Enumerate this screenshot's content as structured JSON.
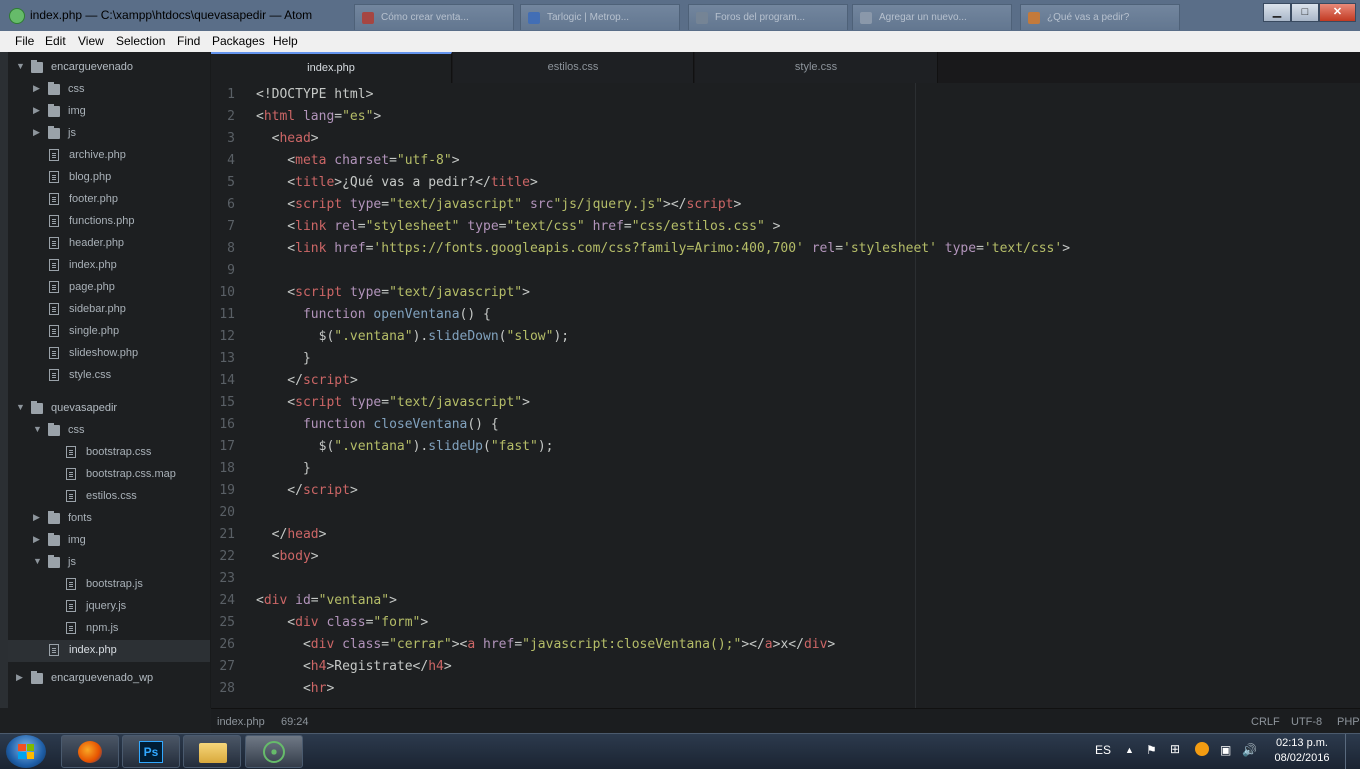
{
  "window": {
    "title": "index.php — C:\\xampp\\htdocs\\quevasapedir — Atom"
  },
  "browser_tabs": [
    {
      "label": "Cómo crear venta...",
      "color": "#c0392b"
    },
    {
      "label": "Tarlogic | Metrop...",
      "color": "#3a6fc4"
    },
    {
      "label": "Foros del program...",
      "color": "#7f8c9a"
    },
    {
      "label": "Agregar un nuevo...",
      "color": "#9aa7b6"
    },
    {
      "label": "¿Qué vas a pedir?",
      "color": "#e67e22"
    }
  ],
  "window_controls": {
    "minimize": "▁",
    "maximize": "□",
    "close": "✕"
  },
  "menu": [
    "File",
    "Edit",
    "View",
    "Selection",
    "Find",
    "Packages",
    "Help"
  ],
  "tree": [
    {
      "type": "folder",
      "label": "encarguevenado",
      "depth": 0,
      "open": true
    },
    {
      "type": "folder",
      "label": "css",
      "depth": 1,
      "open": false
    },
    {
      "type": "folder",
      "label": "img",
      "depth": 1,
      "open": false
    },
    {
      "type": "folder",
      "label": "js",
      "depth": 1,
      "open": false
    },
    {
      "type": "file",
      "label": "archive.php",
      "depth": 1
    },
    {
      "type": "file",
      "label": "blog.php",
      "depth": 1
    },
    {
      "type": "file",
      "label": "footer.php",
      "depth": 1
    },
    {
      "type": "file",
      "label": "functions.php",
      "depth": 1
    },
    {
      "type": "file",
      "label": "header.php",
      "depth": 1
    },
    {
      "type": "file",
      "label": "index.php",
      "depth": 1
    },
    {
      "type": "file",
      "label": "page.php",
      "depth": 1
    },
    {
      "type": "file",
      "label": "sidebar.php",
      "depth": 1
    },
    {
      "type": "file",
      "label": "single.php",
      "depth": 1
    },
    {
      "type": "file",
      "label": "slideshow.php",
      "depth": 1
    },
    {
      "type": "file",
      "label": "style.css",
      "depth": 1
    },
    {
      "type": "folder",
      "label": "quevasapedir",
      "depth": 0,
      "open": true
    },
    {
      "type": "folder",
      "label": "css",
      "depth": 1,
      "open": true
    },
    {
      "type": "file",
      "label": "bootstrap.css",
      "depth": 2
    },
    {
      "type": "file",
      "label": "bootstrap.css.map",
      "depth": 2
    },
    {
      "type": "file",
      "label": "estilos.css",
      "depth": 2
    },
    {
      "type": "folder",
      "label": "fonts",
      "depth": 1,
      "open": false
    },
    {
      "type": "folder",
      "label": "img",
      "depth": 1,
      "open": false
    },
    {
      "type": "folder",
      "label": "js",
      "depth": 1,
      "open": true
    },
    {
      "type": "file",
      "label": "bootstrap.js",
      "depth": 2
    },
    {
      "type": "file",
      "label": "jquery.js",
      "depth": 2
    },
    {
      "type": "file",
      "label": "npm.js",
      "depth": 2
    },
    {
      "type": "file",
      "label": "index.php",
      "depth": 1,
      "selected": true
    },
    {
      "type": "folder",
      "label": "encarguevenado_wp",
      "depth": 0,
      "open": false
    }
  ],
  "tabs": [
    {
      "label": "index.php",
      "active": true
    },
    {
      "label": "estilos.css",
      "active": false
    },
    {
      "label": "style.css",
      "active": false
    }
  ],
  "colors": {
    "tag": "#cc6666",
    "attr": "#b294bb",
    "string": "#b5bd68",
    "keyword": "#b294bb",
    "func": "#81a2be",
    "text": "#c5c8c6",
    "accent": "#6494ed"
  },
  "code": [
    [
      [
        "t",
        "<!DOCTYPE html>"
      ]
    ],
    [
      [
        "t",
        "<"
      ],
      [
        "g",
        "html"
      ],
      [
        "t",
        " "
      ],
      [
        "a",
        "lang"
      ],
      [
        "t",
        "="
      ],
      [
        "s",
        "\"es\""
      ],
      [
        "t",
        ">"
      ]
    ],
    [
      [
        "t",
        "  <"
      ],
      [
        "g",
        "head"
      ],
      [
        "t",
        ">"
      ]
    ],
    [
      [
        "t",
        "    <"
      ],
      [
        "g",
        "meta"
      ],
      [
        "t",
        " "
      ],
      [
        "a",
        "charset"
      ],
      [
        "t",
        "="
      ],
      [
        "s",
        "\"utf-8\""
      ],
      [
        "t",
        ">"
      ]
    ],
    [
      [
        "t",
        "    <"
      ],
      [
        "g",
        "title"
      ],
      [
        "t",
        ">¿Qué vas a pedir?</"
      ],
      [
        "g",
        "title"
      ],
      [
        "t",
        ">"
      ]
    ],
    [
      [
        "t",
        "    <"
      ],
      [
        "g",
        "script"
      ],
      [
        "t",
        " "
      ],
      [
        "a",
        "type"
      ],
      [
        "t",
        "="
      ],
      [
        "s",
        "\"text/javascript\""
      ],
      [
        "t",
        " "
      ],
      [
        "a",
        "src"
      ],
      [
        "s",
        "\"js/jquery.js\""
      ],
      [
        "t",
        "></"
      ],
      [
        "g",
        "script"
      ],
      [
        "t",
        ">"
      ]
    ],
    [
      [
        "t",
        "    <"
      ],
      [
        "g",
        "link"
      ],
      [
        "t",
        " "
      ],
      [
        "a",
        "rel"
      ],
      [
        "t",
        "="
      ],
      [
        "s",
        "\"stylesheet\""
      ],
      [
        "t",
        " "
      ],
      [
        "a",
        "type"
      ],
      [
        "t",
        "="
      ],
      [
        "s",
        "\"text/css\""
      ],
      [
        "t",
        " "
      ],
      [
        "a",
        "href"
      ],
      [
        "t",
        "="
      ],
      [
        "s",
        "\"css/estilos.css\""
      ],
      [
        "t",
        " >"
      ]
    ],
    [
      [
        "t",
        "    <"
      ],
      [
        "g",
        "link"
      ],
      [
        "t",
        " "
      ],
      [
        "a",
        "href"
      ],
      [
        "t",
        "="
      ],
      [
        "s",
        "'https://fonts.googleapis.com/css?family=Arimo:400,700'"
      ],
      [
        "t",
        " "
      ],
      [
        "a",
        "rel"
      ],
      [
        "t",
        "="
      ],
      [
        "s",
        "'stylesheet'"
      ],
      [
        "t",
        " "
      ],
      [
        "a",
        "type"
      ],
      [
        "t",
        "="
      ],
      [
        "s",
        "'text/css'"
      ],
      [
        "t",
        ">"
      ]
    ],
    [
      [
        "t",
        ""
      ]
    ],
    [
      [
        "t",
        "    <"
      ],
      [
        "g",
        "script"
      ],
      [
        "t",
        " "
      ],
      [
        "a",
        "type"
      ],
      [
        "t",
        "="
      ],
      [
        "s",
        "\"text/javascript\""
      ],
      [
        "t",
        ">"
      ]
    ],
    [
      [
        "t",
        "      "
      ],
      [
        "k",
        "function"
      ],
      [
        "t",
        " "
      ],
      [
        "f",
        "openVentana"
      ],
      [
        "t",
        "() {"
      ]
    ],
    [
      [
        "t",
        "        $("
      ],
      [
        "s",
        "\".ventana\""
      ],
      [
        "t",
        ")."
      ],
      [
        "f",
        "slideDown"
      ],
      [
        "t",
        "("
      ],
      [
        "s",
        "\"slow\""
      ],
      [
        "t",
        ");"
      ]
    ],
    [
      [
        "t",
        "      }"
      ]
    ],
    [
      [
        "t",
        "    </"
      ],
      [
        "g",
        "script"
      ],
      [
        "t",
        ">"
      ]
    ],
    [
      [
        "t",
        "    <"
      ],
      [
        "g",
        "script"
      ],
      [
        "t",
        " "
      ],
      [
        "a",
        "type"
      ],
      [
        "t",
        "="
      ],
      [
        "s",
        "\"text/javascript\""
      ],
      [
        "t",
        ">"
      ]
    ],
    [
      [
        "t",
        "      "
      ],
      [
        "k",
        "function"
      ],
      [
        "t",
        " "
      ],
      [
        "f",
        "closeVentana"
      ],
      [
        "t",
        "() {"
      ]
    ],
    [
      [
        "t",
        "        $("
      ],
      [
        "s",
        "\".ventana\""
      ],
      [
        "t",
        ")."
      ],
      [
        "f",
        "slideUp"
      ],
      [
        "t",
        "("
      ],
      [
        "s",
        "\"fast\""
      ],
      [
        "t",
        ");"
      ]
    ],
    [
      [
        "t",
        "      }"
      ]
    ],
    [
      [
        "t",
        "    </"
      ],
      [
        "g",
        "script"
      ],
      [
        "t",
        ">"
      ]
    ],
    [
      [
        "t",
        ""
      ]
    ],
    [
      [
        "t",
        "  </"
      ],
      [
        "g",
        "head"
      ],
      [
        "t",
        ">"
      ]
    ],
    [
      [
        "t",
        "  <"
      ],
      [
        "g",
        "body"
      ],
      [
        "t",
        ">"
      ]
    ],
    [
      [
        "t",
        ""
      ]
    ],
    [
      [
        "t",
        "<"
      ],
      [
        "g",
        "div"
      ],
      [
        "t",
        " "
      ],
      [
        "a",
        "id"
      ],
      [
        "t",
        "="
      ],
      [
        "s",
        "\"ventana\""
      ],
      [
        "t",
        ">"
      ]
    ],
    [
      [
        "t",
        "    <"
      ],
      [
        "g",
        "div"
      ],
      [
        "t",
        " "
      ],
      [
        "a",
        "class"
      ],
      [
        "t",
        "="
      ],
      [
        "s",
        "\"form\""
      ],
      [
        "t",
        ">"
      ]
    ],
    [
      [
        "t",
        "      <"
      ],
      [
        "g",
        "div"
      ],
      [
        "t",
        " "
      ],
      [
        "a",
        "class"
      ],
      [
        "t",
        "="
      ],
      [
        "s",
        "\"cerrar\""
      ],
      [
        "t",
        "><"
      ],
      [
        "g",
        "a"
      ],
      [
        "t",
        " "
      ],
      [
        "a",
        "href"
      ],
      [
        "t",
        "="
      ],
      [
        "s",
        "\"javascript:closeVentana();\""
      ],
      [
        "t",
        "></"
      ],
      [
        "g",
        "a"
      ],
      [
        "t",
        ">x</"
      ],
      [
        "g",
        "div"
      ],
      [
        "t",
        ">"
      ]
    ],
    [
      [
        "t",
        "      <"
      ],
      [
        "g",
        "h4"
      ],
      [
        "t",
        ">Registrate</"
      ],
      [
        "g",
        "h4"
      ],
      [
        "t",
        ">"
      ]
    ],
    [
      [
        "t",
        "      <"
      ],
      [
        "g",
        "hr"
      ],
      [
        "t",
        ">"
      ]
    ]
  ],
  "status": {
    "file": "index.php",
    "cursor": "69:24",
    "line_ending": "CRLF",
    "encoding": "UTF-8",
    "grammar": "PHP"
  },
  "taskbar": {
    "apps": [
      {
        "name": "firefox",
        "active": false
      },
      {
        "name": "photoshop",
        "label": "Ps",
        "active": false
      },
      {
        "name": "explorer",
        "active": false
      },
      {
        "name": "atom",
        "active": true
      }
    ],
    "lang": "ES",
    "time": "02:13 p.m.",
    "date": "08/02/2016"
  }
}
